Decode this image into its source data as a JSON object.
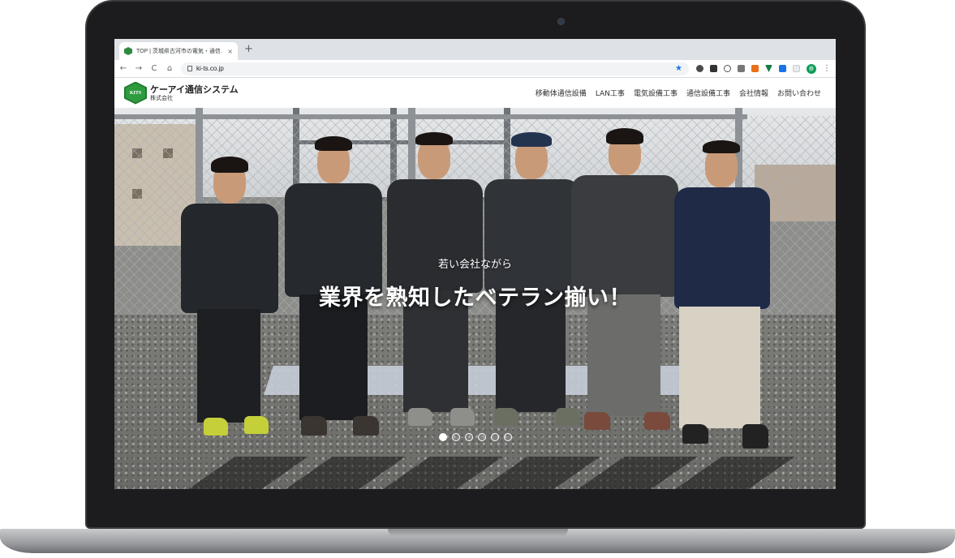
{
  "browser": {
    "tab_title": "TOP | 茨城県古河市の電気・通信…",
    "tab_close": "×",
    "new_tab": "+",
    "back": "←",
    "forward": "→",
    "reload": "C",
    "home": "⌂",
    "url": "ki-ts.co.jp",
    "star": "★",
    "profile_initial": "移",
    "menu": "⋮"
  },
  "site": {
    "logo_mark_text": "KITS",
    "company_name": "ケーアイ通信システム",
    "company_type": "株式会社",
    "nav": [
      {
        "label": "移動体通信設備"
      },
      {
        "label": "LAN工事"
      },
      {
        "label": "電気設備工事"
      },
      {
        "label": "通信設備工事"
      },
      {
        "label": "会社情報"
      },
      {
        "label": "お問い合わせ"
      }
    ]
  },
  "hero": {
    "subtitle": "若い会社ながら",
    "title": "業界を熟知したベテラン揃い！",
    "slide_count": 6,
    "active_slide": 1
  },
  "colors": {
    "brand_green": "#2e9b3f",
    "bookmark_star": "#1a73e8"
  }
}
